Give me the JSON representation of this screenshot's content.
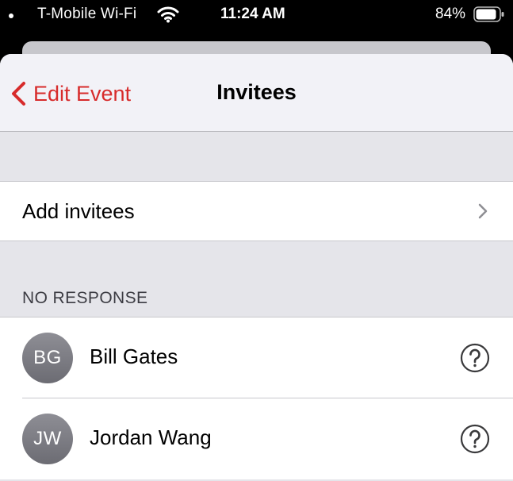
{
  "status_bar": {
    "carrier": "T-Mobile Wi-Fi",
    "time": "11:24 AM",
    "battery_percent": "84%",
    "icons": [
      "wifi-icon",
      "battery-icon"
    ]
  },
  "nav": {
    "back_label": "Edit Event",
    "title": "Invitees",
    "accent_color": "#d72b2b"
  },
  "add_invitees": {
    "label": "Add invitees"
  },
  "sections": {
    "no_response": {
      "header": "NO RESPONSE",
      "invitees": [
        {
          "initials": "BG",
          "name": "Bill Gates",
          "status_icon": "question-circle-icon"
        },
        {
          "initials": "JW",
          "name": "Jordan Wang",
          "status_icon": "question-circle-icon"
        }
      ]
    }
  }
}
